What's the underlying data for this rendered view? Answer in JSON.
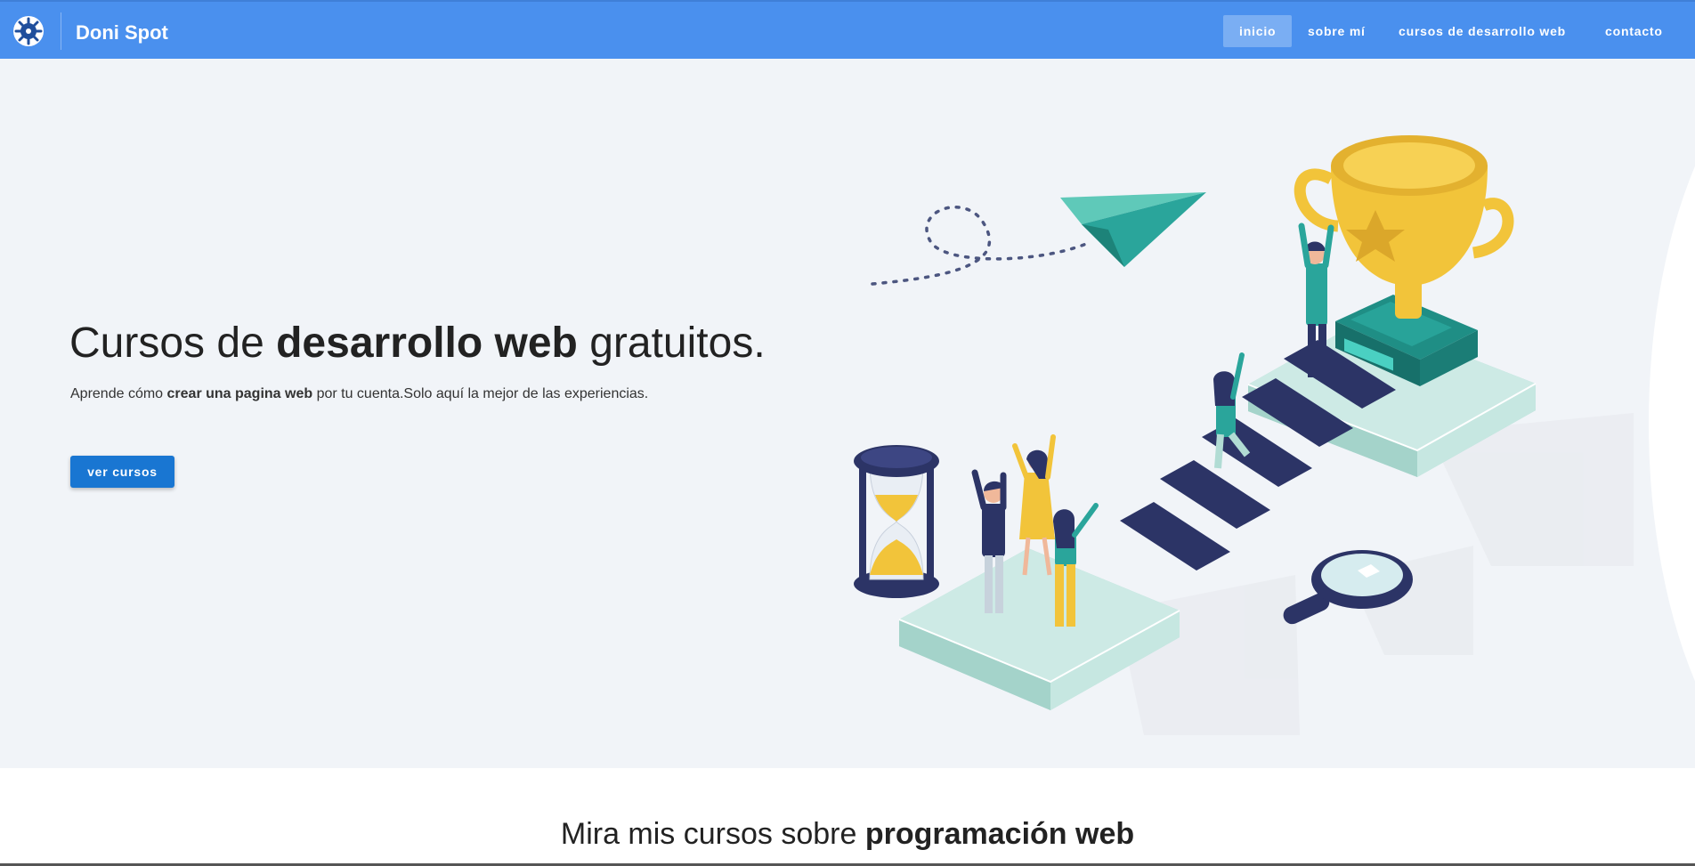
{
  "navbar": {
    "brand": "Doni Spot",
    "links": [
      {
        "label": "inicio",
        "active": true
      },
      {
        "label": "sobre mí",
        "active": false
      },
      {
        "label": "cursos de desarrollo web",
        "active": false
      },
      {
        "label": "contacto",
        "active": false
      }
    ]
  },
  "hero": {
    "title_pre": "Cursos de ",
    "title_bold": "desarrollo web",
    "title_post": " gratuitos.",
    "subtitle_pre": "Aprende cómo ",
    "subtitle_bold": "crear una pagina web",
    "subtitle_post": " por tu cuenta.Solo aquí la mejor de las experiencias.",
    "button_label": "ver cursos"
  },
  "section": {
    "heading_pre": "Mira mis cursos sobre ",
    "heading_bold": "programación web"
  },
  "colors": {
    "navbar": "#4a90ee",
    "hero_bg": "#f1f4f8",
    "button": "#1976d2",
    "navy": "#2c3466",
    "teal": "#2aa59b",
    "gold": "#f2c43a"
  }
}
